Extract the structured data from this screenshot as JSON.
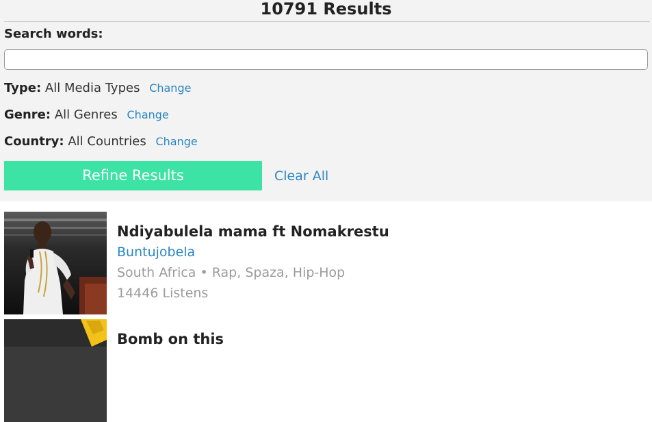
{
  "header": {
    "results_count": "10791 Results"
  },
  "search": {
    "label": "Search words:",
    "value": "",
    "placeholder": ""
  },
  "filters": [
    {
      "label": "Type:",
      "value": "All Media Types",
      "change_label": "Change"
    },
    {
      "label": "Genre:",
      "value": "All Genres",
      "change_label": "Change"
    },
    {
      "label": "Country:",
      "value": "All Countries",
      "change_label": "Change"
    }
  ],
  "actions": {
    "refine_label": "Refine Results",
    "clear_label": "Clear All"
  },
  "results": [
    {
      "title": "Ndiyabulela mama ft Nomakrestu",
      "artist": "Buntujobela",
      "country": "South Africa",
      "separator": " • ",
      "genres": "Rap, Spaza, Hip-Hop",
      "listens": "14446 Listens"
    },
    {
      "title": "Bomb on this"
    }
  ],
  "colors": {
    "accent_green": "#3de2a5",
    "link_blue": "#2a86c4",
    "panel_bg": "#f3f3f3",
    "meta_gray": "#9b9b9b"
  }
}
